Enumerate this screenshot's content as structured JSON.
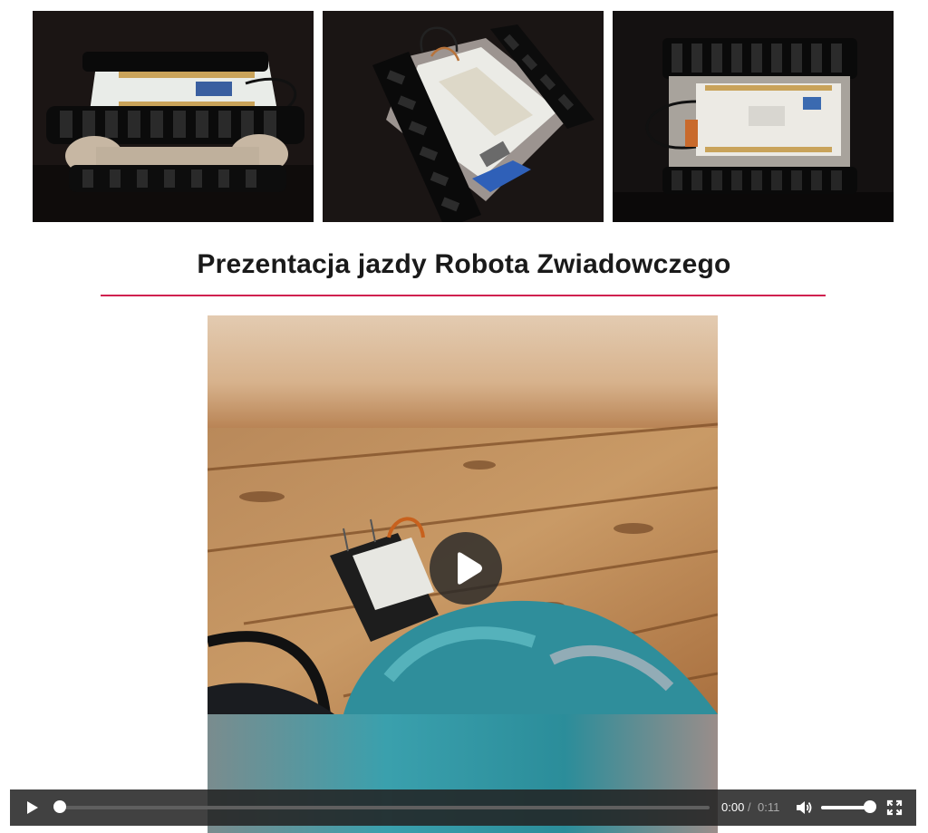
{
  "gallery": {
    "photos": [
      {
        "description_icon": "robot-tracked-chassis-side-photo"
      },
      {
        "description_icon": "robot-tracked-chassis-angled-photo"
      },
      {
        "description_icon": "robot-tracked-chassis-top-photo"
      }
    ]
  },
  "section": {
    "title": "Prezentacja jazdy Robota Zwiadowczego",
    "rule_color": "#d0214f"
  },
  "video": {
    "play_overlay_icon": "play-icon",
    "controls": {
      "current_time": "0:00",
      "separator": "/",
      "duration": "0:11",
      "progress": 0,
      "volume": 1,
      "play_icon": "play-icon",
      "volume_icon": "volume-icon",
      "fullscreen_icon": "fullscreen-icon"
    }
  }
}
